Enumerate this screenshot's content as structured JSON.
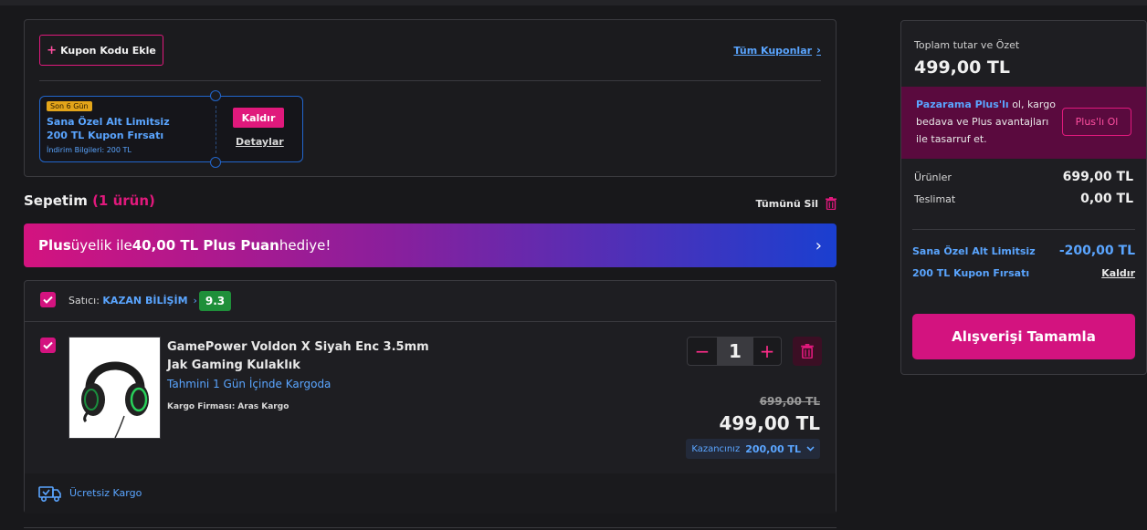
{
  "coupons": {
    "add_label": "Kupon Kodu Ekle",
    "all_label": "Tüm Kuponlar",
    "card": {
      "badge": "Son 6 Gün",
      "title": "Sana Özel Alt Limitsiz 200 TL Kupon Fırsatı",
      "info_label": "İndirim Bilgileri:",
      "info_value": "200 TL",
      "remove_label": "Kaldır",
      "details_label": "Detaylar"
    }
  },
  "cart": {
    "title": "Sepetim",
    "count": "(1 ürün)",
    "clear_all": "Tümünü Sil"
  },
  "plus_banner": {
    "part1": "Plus",
    "part2": " üyelik ile ",
    "part3": "40,00 TL Plus Puan",
    "part4": " hediye!"
  },
  "seller": {
    "label": "Satıcı:",
    "name": "KAZAN BİLİŞİM",
    "score": "9.3"
  },
  "item": {
    "name": "GamePower Voldon X Siyah Enc 3.5mm Jak Gaming Kulaklık",
    "shipping_estimate": "Tahmini 1 Gün İçinde Kargoda",
    "carrier_label": "Kargo Firması:",
    "carrier_name": "Aras Kargo",
    "quantity": "1",
    "old_price": "699,00 TL",
    "price": "499,00 TL",
    "savings_label": "Kazancınız",
    "savings_value": "200,00 TL",
    "free_shipping": "Ücretsiz Kargo"
  },
  "summary": {
    "label": "Toplam tutar ve Özet",
    "total": "499,00 TL",
    "plus_promo_bold": "Pazarama Plus'lı",
    "plus_promo_text": " ol, kargo bedava ve Plus avantajları ile tasarruf et.",
    "plus_button": "Plus'lı Ol",
    "products_label": "Ürünler",
    "products_value": "699,00 TL",
    "delivery_label": "Teslimat",
    "delivery_value": "0,00 TL",
    "discount_line1": "Sana Özel Alt Limitsiz",
    "discount_line2": "200 TL Kupon Fırsatı",
    "discount_value": "-200,00 TL",
    "discount_remove": "Kaldır",
    "checkout": "Alışverişi Tamamla"
  },
  "colors": {
    "accent": "#d3137f",
    "link": "#5aa5ff",
    "background": "#18181b"
  }
}
